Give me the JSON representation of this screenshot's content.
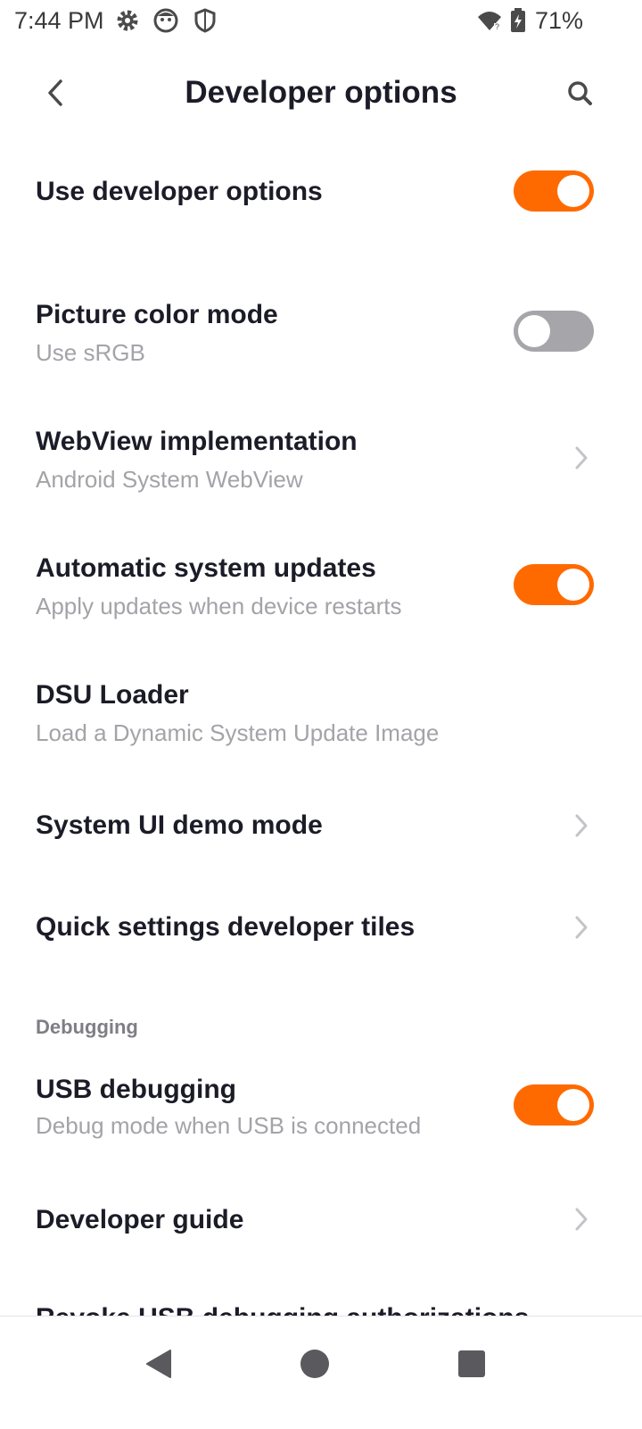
{
  "status_bar": {
    "time": "7:44 PM",
    "icons_left": [
      "gear-icon",
      "face-icon",
      "shield-icon"
    ],
    "icons_right": [
      "wifi-icon",
      "battery-charging-icon"
    ],
    "battery": "71%"
  },
  "header": {
    "title": "Developer options",
    "back_icon": "chevron-left-icon",
    "search_icon": "search-icon"
  },
  "settings": [
    {
      "title": "Use developer options",
      "subtitle": "",
      "control": "toggle",
      "state": true
    },
    {
      "title": "Picture color mode",
      "subtitle": "Use sRGB",
      "control": "toggle",
      "state": false
    },
    {
      "title": "WebView implementation",
      "subtitle": "Android System WebView",
      "control": "chevron"
    },
    {
      "title": "Automatic system updates",
      "subtitle": "Apply updates when device restarts",
      "control": "toggle",
      "state": true
    },
    {
      "title": "DSU Loader",
      "subtitle": "Load a Dynamic System Update Image",
      "control": "none"
    },
    {
      "title": "System UI demo mode",
      "subtitle": "",
      "control": "chevron"
    },
    {
      "title": "Quick settings developer tiles",
      "subtitle": "",
      "control": "chevron"
    }
  ],
  "debugging": {
    "section_label": "Debugging",
    "items": [
      {
        "title": "USB debugging",
        "subtitle": "Debug mode when USB is connected",
        "control": "toggle",
        "state": true
      },
      {
        "title": "Developer guide",
        "subtitle": "",
        "control": "chevron"
      },
      {
        "title": "Revoke USB debugging authorizations",
        "subtitle": "",
        "control": "none"
      }
    ]
  },
  "nav_bar": {
    "icons": [
      "back-triangle-icon",
      "home-circle-icon",
      "recents-square-icon"
    ]
  },
  "colors": {
    "accent": "#ff6a00",
    "toggle_off": "#a6a6aa",
    "title_text": "#1c1c28",
    "subtitle_text": "#a3a3a8"
  }
}
